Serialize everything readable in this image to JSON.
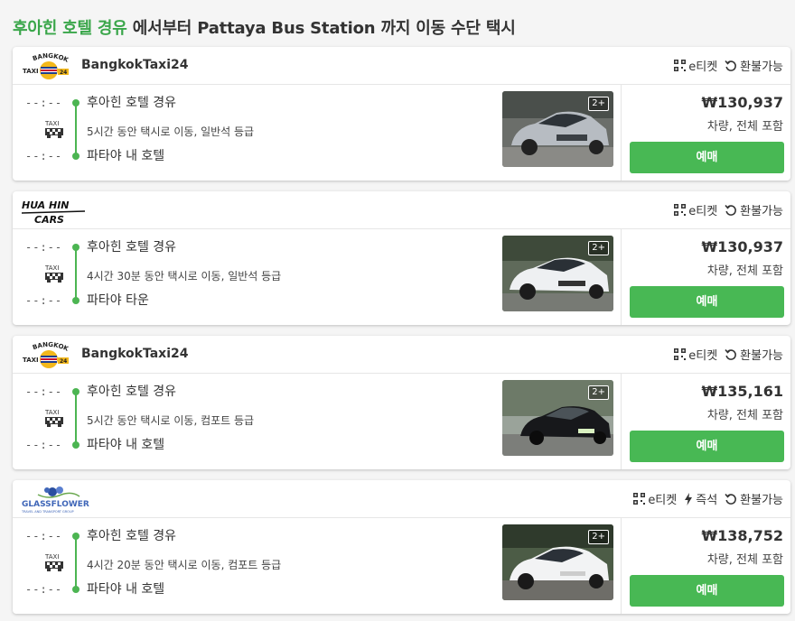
{
  "header": {
    "origin": "후아힌 호텔 경유",
    "rest": " 에서부터 Pattaya Bus Station 까지 이동 수단 택시"
  },
  "colors": {
    "accent": "#3aa64a",
    "button": "#48b854",
    "timeline": "#4cb552"
  },
  "results": [
    {
      "logo": "bangkok-taxi24-logo",
      "operator": "BangkokTaxi24",
      "features": [
        "e티켓",
        "환불가능"
      ],
      "time_from": "--:--",
      "time_to": "--:--",
      "from": "후아힌 호텔 경유",
      "description": "5시간 동안 택시로 이동, 일반석 등급",
      "to": "파타야 내 호텔",
      "pax": "2+",
      "price": "₩130,937",
      "price_note": "차량, 전체 포함",
      "book_label": "예매"
    },
    {
      "logo": "hua-hin-cars-logo",
      "operator": "",
      "features": [
        "e티켓",
        "환불가능"
      ],
      "time_from": "--:--",
      "time_to": "--:--",
      "from": "후아힌 호텔 경유",
      "description": "4시간 30분 동안 택시로 이동, 일반석 등급",
      "to": "파타야 타운",
      "pax": "2+",
      "price": "₩130,937",
      "price_note": "차량, 전체 포함",
      "book_label": "예매"
    },
    {
      "logo": "bangkok-taxi24-logo",
      "operator": "BangkokTaxi24",
      "features": [
        "e티켓",
        "환불가능"
      ],
      "time_from": "--:--",
      "time_to": "--:--",
      "from": "후아힌 호텔 경유",
      "description": "5시간 동안 택시로 이동, 컴포트 등급",
      "to": "파타야 내 호텔",
      "pax": "2+",
      "price": "₩135,161",
      "price_note": "차량, 전체 포함",
      "book_label": "예매"
    },
    {
      "logo": "glassflower-logo",
      "operator": "",
      "features": [
        "e티켓",
        "즉석",
        "환불가능"
      ],
      "time_from": "--:--",
      "time_to": "--:--",
      "from": "후아힌 호텔 경유",
      "description": "4시간 20분 동안 택시로 이동, 컴포트 등급",
      "to": "파타야 내 호텔",
      "pax": "2+",
      "price": "₩138,752",
      "price_note": "차량, 전체 포함",
      "book_label": "예매"
    }
  ]
}
